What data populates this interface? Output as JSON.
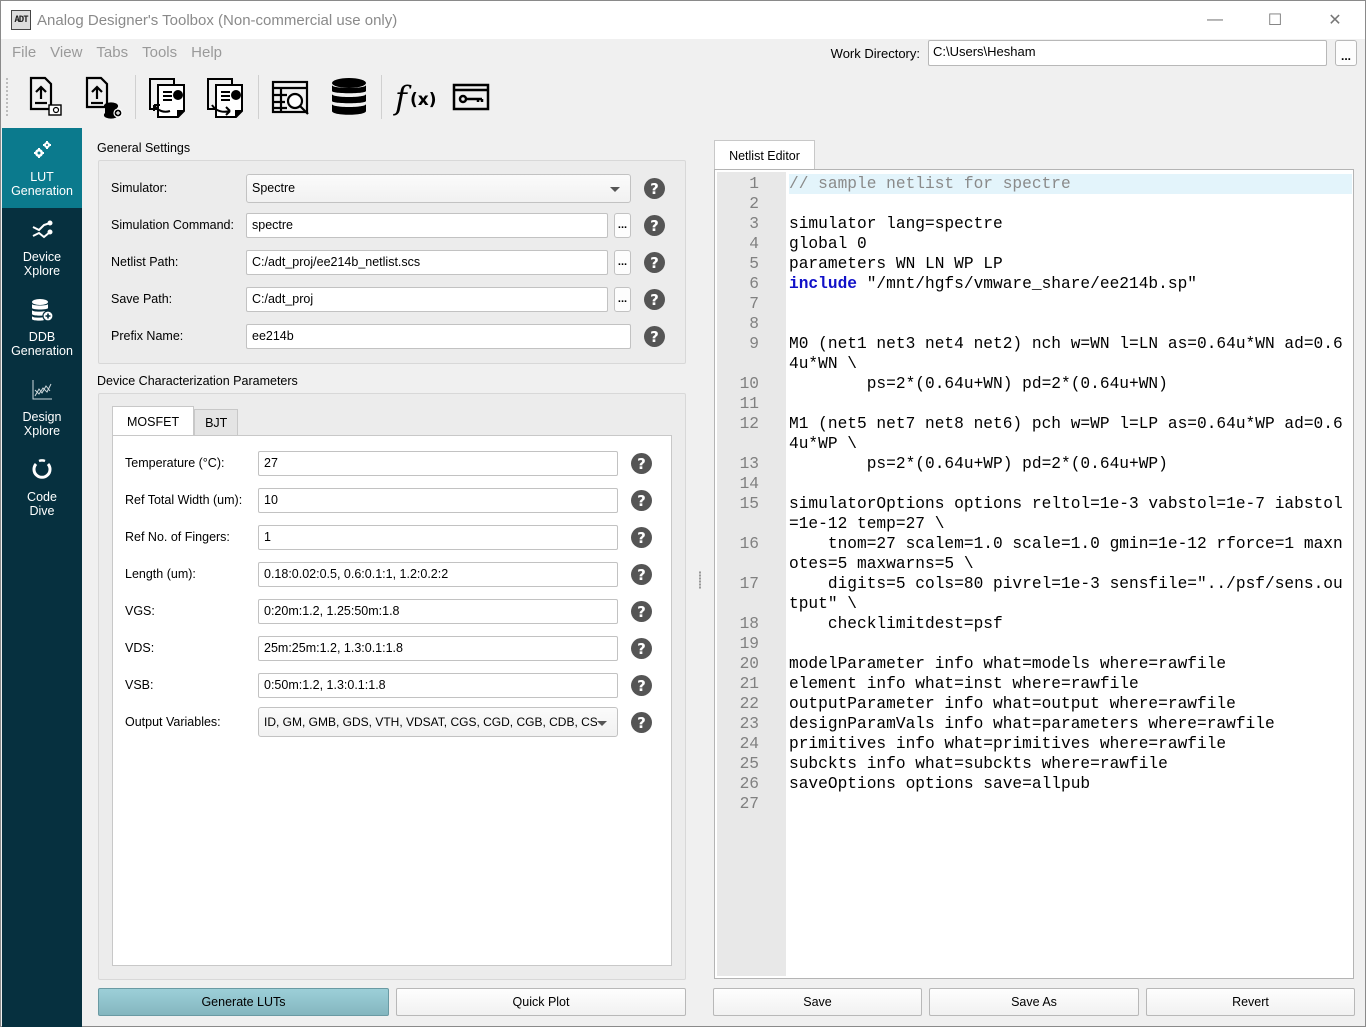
{
  "window": {
    "title": "Analog Designer's Toolbox (Non-commercial use only)",
    "app_icon_text": "ADT",
    "controls": {
      "minimize": "—",
      "maximize": "☐",
      "close": "✕"
    }
  },
  "menu": [
    "File",
    "View",
    "Tabs",
    "Tools",
    "Help"
  ],
  "work_directory": {
    "label": "Work Directory:",
    "value": "C:\\Users\\Hesham",
    "browse_label": "..."
  },
  "toolbar": [
    {
      "icon": "load-lut-icon"
    },
    {
      "icon": "load-ddb-icon"
    },
    {
      "icon": "import-session-icon"
    },
    {
      "icon": "export-session-icon"
    },
    {
      "icon": "lut-browser-icon"
    },
    {
      "icon": "database-icon"
    },
    {
      "icon": "function-icon"
    },
    {
      "icon": "license-key-icon"
    }
  ],
  "sidebar": [
    {
      "label1": "LUT",
      "label2": "Generation",
      "icon": "gears-icon",
      "active": true
    },
    {
      "label1": "Device",
      "label2": "Xplore",
      "icon": "chart-line-icon",
      "active": false
    },
    {
      "label1": "DDB",
      "label2": "Generation",
      "icon": "database-add-icon",
      "active": false
    },
    {
      "label1": "Design",
      "label2": "Xplore",
      "icon": "design-chart-icon",
      "active": false
    },
    {
      "label1": "Code",
      "label2": "Dive",
      "icon": "code-dive-icon",
      "active": false
    }
  ],
  "general_settings": {
    "title": "General Settings",
    "simulator": {
      "label": "Simulator:",
      "value": "Spectre"
    },
    "sim_command": {
      "label": "Simulation Command:",
      "value": "spectre"
    },
    "netlist_path": {
      "label": "Netlist Path:",
      "value": "C:/adt_proj/ee214b_netlist.scs"
    },
    "save_path": {
      "label": "Save Path:",
      "value": "C:/adt_proj"
    },
    "prefix": {
      "label": "Prefix Name:",
      "value": "ee214b"
    },
    "browse_label": "...",
    "help_glyph": "?"
  },
  "device_params": {
    "title": "Device Characterization Parameters",
    "tabs": [
      "MOSFET",
      "BJT"
    ],
    "active_tab": "MOSFET",
    "fields": [
      {
        "label": "Temperature (°C):",
        "value": "27"
      },
      {
        "label": "Ref Total Width (um):",
        "value": "10"
      },
      {
        "label": "Ref No. of Fingers:",
        "value": "1"
      },
      {
        "label": "Length (um):",
        "value": "0.18:0.02:0.5, 0.6:0.1:1, 1.2:0.2:2"
      },
      {
        "label": "VGS:",
        "value": "0:20m:1.2, 1.25:50m:1.8"
      },
      {
        "label": "VDS:",
        "value": "25m:25m:1.2, 1.3:0.1:1.8"
      },
      {
        "label": "VSB:",
        "value": "0:50m:1.2, 1.3:0.1:1.8"
      }
    ],
    "output_variables": {
      "label": "Output Variables:",
      "value": "ID, GM, GMB, GDS, VTH, VDSAT, CGS, CGD, CGB, CDB, CS"
    }
  },
  "left_buttons": {
    "generate": "Generate LUTs",
    "quick_plot": "Quick Plot"
  },
  "editor": {
    "tab": "Netlist Editor",
    "lines": [
      {
        "n": "1",
        "text": "// sample netlist for spectre",
        "type": "comment",
        "current": true
      },
      {
        "n": "2",
        "text": ""
      },
      {
        "n": "3",
        "text": "simulator lang=spectre"
      },
      {
        "n": "4",
        "text": "global 0"
      },
      {
        "n": "5",
        "text": "parameters WN LN WP LP"
      },
      {
        "n": "6",
        "kw": "include",
        "text": " \"/mnt/hgfs/vmware_share/ee214b.sp\""
      },
      {
        "n": "7",
        "text": ""
      },
      {
        "n": "8",
        "text": ""
      },
      {
        "n": "9",
        "text": "M0 (net1 net3 net4 net2) nch w=WN l=LN as=0.64u*WN ad=0.64u*WN \\"
      },
      {
        "n": "10",
        "text": "        ps=2*(0.64u+WN) pd=2*(0.64u+WN)"
      },
      {
        "n": "11",
        "text": ""
      },
      {
        "n": "12",
        "text": "M1 (net5 net7 net8 net6) pch w=WP l=LP as=0.64u*WP ad=0.64u*WP \\"
      },
      {
        "n": "13",
        "text": "        ps=2*(0.64u+WP) pd=2*(0.64u+WP)"
      },
      {
        "n": "14",
        "text": ""
      },
      {
        "n": "15",
        "text": "simulatorOptions options reltol=1e-3 vabstol=1e-7 iabstol=1e-12 temp=27 \\"
      },
      {
        "n": "16",
        "text": "    tnom=27 scalem=1.0 scale=1.0 gmin=1e-12 rforce=1 maxnotes=5 maxwarns=5 \\"
      },
      {
        "n": "17",
        "text": "    digits=5 cols=80 pivrel=1e-3 sensfile=\"../psf/sens.output\" \\"
      },
      {
        "n": "18",
        "text": "    checklimitdest=psf"
      },
      {
        "n": "19",
        "text": ""
      },
      {
        "n": "20",
        "text": "modelParameter info what=models where=rawfile"
      },
      {
        "n": "21",
        "text": "element info what=inst where=rawfile"
      },
      {
        "n": "22",
        "text": "outputParameter info what=output where=rawfile"
      },
      {
        "n": "23",
        "text": "designParamVals info what=parameters where=rawfile"
      },
      {
        "n": "24",
        "text": "primitives info what=primitives where=rawfile"
      },
      {
        "n": "25",
        "text": "subckts info what=subckts where=rawfile"
      },
      {
        "n": "26",
        "text": "saveOptions options save=allpub"
      },
      {
        "n": "27",
        "text": ""
      }
    ]
  },
  "editor_buttons": {
    "save": "Save",
    "save_as": "Save As",
    "revert": "Revert"
  },
  "colors": {
    "sidebar_bg": "#06303f",
    "sidebar_active": "#0b7a8d",
    "primary_button": "#93c5ce",
    "keyword": "#1010c8",
    "current_line": "#e3f4fb"
  }
}
